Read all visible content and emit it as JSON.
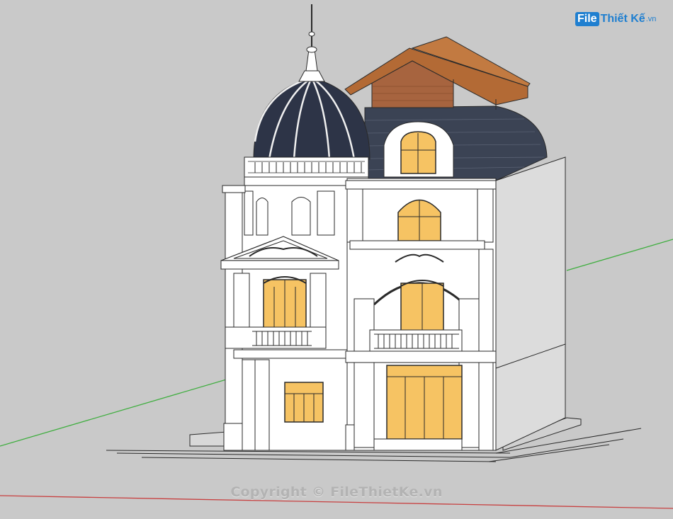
{
  "watermark": {
    "logo_box": "File",
    "logo_rest": "Thiết Kế",
    "logo_tld": ".vn",
    "copyright": "Copyright © FileThietKe.vn"
  },
  "colors": {
    "background": "#c9c9c9",
    "wall": "#ffffff",
    "side_wall": "#dcdcdc",
    "roof_dark": "#3b4354",
    "dome": "#2d3447",
    "wood_roof": "#b36a35",
    "brick": "#a7643f",
    "window_glass": "#f6c363",
    "outline": "#2a2a2a",
    "axis_green": "#3fae3f",
    "axis_red": "#c84040",
    "logo_blue": "#1f7fd0"
  },
  "scene": {
    "subject": "house-3d-model",
    "icons": [
      "dome-icon",
      "window-icon",
      "column-icon",
      "balcony-icon"
    ]
  }
}
